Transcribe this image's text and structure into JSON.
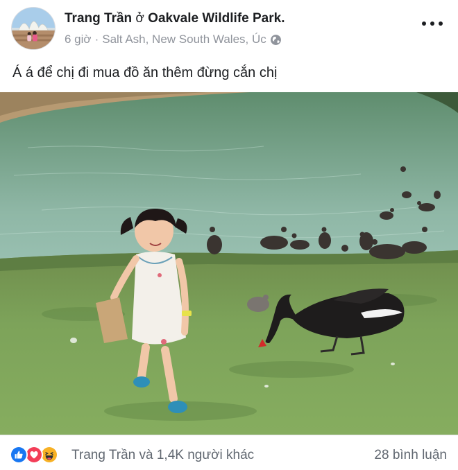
{
  "post": {
    "author": "Trang Trần",
    "connector": " ở ",
    "location": "Oakvale Wildlife Park.",
    "time": "6 giờ",
    "separator": "·",
    "place": "Salt Ash, New South Wales, Úc",
    "privacy_icon": "globe-icon",
    "caption": "Á á để chị đi mua đồ ăn thêm đừng cắn chị"
  },
  "footer": {
    "reactions": [
      "like-icon",
      "love-icon",
      "haha-icon"
    ],
    "reactors_text": "Trang Trần và 1,4K người khác",
    "comments_text": "28 bình luận"
  },
  "colors": {
    "like": "#1877f2",
    "love": "#f33e58",
    "haha": "#f7b125",
    "meta_text": "#90949c"
  }
}
